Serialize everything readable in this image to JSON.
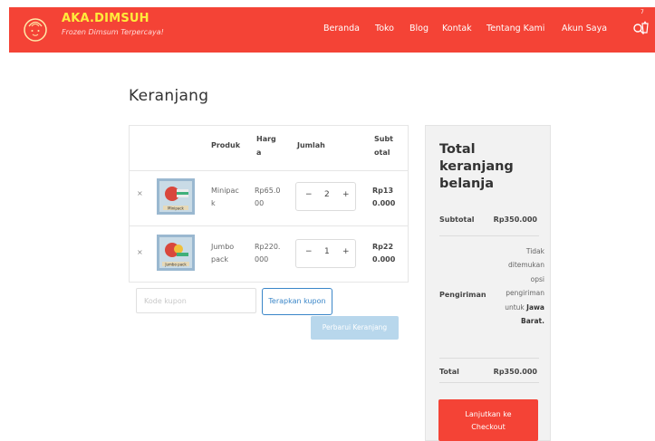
{
  "header": {
    "brand": "AKA.DIMSUH",
    "tagline": "Frozen Dimsum Terpercaya!",
    "nav": [
      {
        "key": "beranda",
        "label": "Beranda"
      },
      {
        "key": "toko",
        "label": "Toko"
      },
      {
        "key": "blog",
        "label": "Blog"
      },
      {
        "key": "kontak",
        "label": "Kontak"
      },
      {
        "key": "tentang",
        "label": "Tentang Kami"
      },
      {
        "key": "akun",
        "label": "Akun Saya"
      }
    ],
    "cart_count": "7",
    "colors": {
      "bar": "#f44336",
      "brand": "#ffeb3b"
    }
  },
  "page": {
    "title": "Keranjang"
  },
  "cart": {
    "headers": {
      "product": "Produk",
      "price": "Harga",
      "qty": "Jumlah",
      "subtotal": "Subtotal"
    },
    "remove_symbol": "×",
    "items": [
      {
        "name": "Minipack",
        "thumb_label": "Minipack",
        "price": "Rp65.000",
        "qty": "2",
        "subtotal": "Rp130.000"
      },
      {
        "name": "Jumbo pack",
        "thumb_label": "Jumbo pack",
        "price": "Rp220.000",
        "qty": "1",
        "subtotal": "Rp220.000"
      }
    ],
    "qty_minus": "−",
    "qty_plus": "+",
    "coupon_placeholder": "Kode kupon",
    "coupon_button": "Terapkan kupon",
    "update_button": "Perbarui Keranjang"
  },
  "totals": {
    "title": "Total keranjang belanja",
    "subtotal_label": "Subtotal",
    "subtotal_value": "Rp350.000",
    "shipping_label": "Pengiriman",
    "shipping_note_prefix": "Tidak ditemukan opsi pengiriman untuk",
    "shipping_note_region": "Jawa Barat.",
    "total_label": "Total",
    "total_value": "Rp350.000",
    "checkout_button": "Lanjutkan ke Checkout"
  }
}
